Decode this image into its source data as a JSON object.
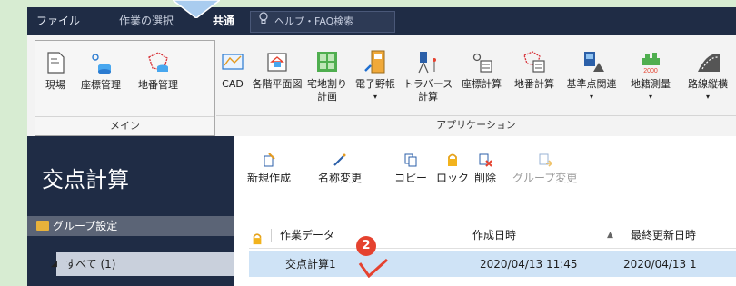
{
  "tabs": [
    {
      "label": "ファイル"
    },
    {
      "label": "作業の選択"
    },
    {
      "label": "共通"
    }
  ],
  "help_search": {
    "placeholder": "ヘルプ・FAQ検索"
  },
  "ribbon": {
    "main_group": {
      "label": "メイン",
      "buttons": [
        {
          "label": "現場",
          "icon": "document-icon"
        },
        {
          "label": "座標管理",
          "icon": "coordinate-icon"
        },
        {
          "label": "地番管理",
          "icon": "parcel-icon"
        }
      ]
    },
    "apps_group": {
      "label": "アプリケーション",
      "buttons": [
        {
          "label": "CAD",
          "icon": "cad-icon"
        },
        {
          "label": "各階平面図",
          "icon": "floorplan-icon"
        },
        {
          "label": "宅地割り",
          "label2": "計画",
          "icon": "lot-plan-icon"
        },
        {
          "label": "電子野帳",
          "icon": "field-book-icon"
        },
        {
          "label": "トラバース",
          "label2": "計算",
          "icon": "traverse-icon"
        },
        {
          "label": "座標計算",
          "icon": "coordinate-calc-icon"
        },
        {
          "label": "地番計算",
          "icon": "parcel-calc-icon"
        },
        {
          "label": "基準点関連",
          "icon": "benchmark-icon"
        },
        {
          "label": "地籍測量",
          "icon": "cadastral-icon",
          "badge": "2000"
        },
        {
          "label": "路線縦横",
          "icon": "route-icon"
        }
      ]
    }
  },
  "sidebar": {
    "title": "交点計算",
    "group_setting": "グループ設定",
    "all": "すべて (1)"
  },
  "toolbar": {
    "new": "新規作成",
    "rename": "名称変更",
    "copy": "コピー",
    "lock": "ロック",
    "delete": "削除",
    "group_change": "グループ変更"
  },
  "table": {
    "headers": {
      "name": "作業データ",
      "created": "作成日時",
      "updated": "最終更新日時"
    },
    "rows": [
      {
        "name": "交点計算1",
        "created": "2020/04/13 11:45",
        "updated": "2020/04/13 1"
      }
    ]
  },
  "annotation": {
    "step": "2"
  },
  "colors": {
    "dark": "#1f2c45",
    "accent": "#e5422f",
    "selection": "#cfe3f6",
    "background": "#d7ecd2"
  }
}
